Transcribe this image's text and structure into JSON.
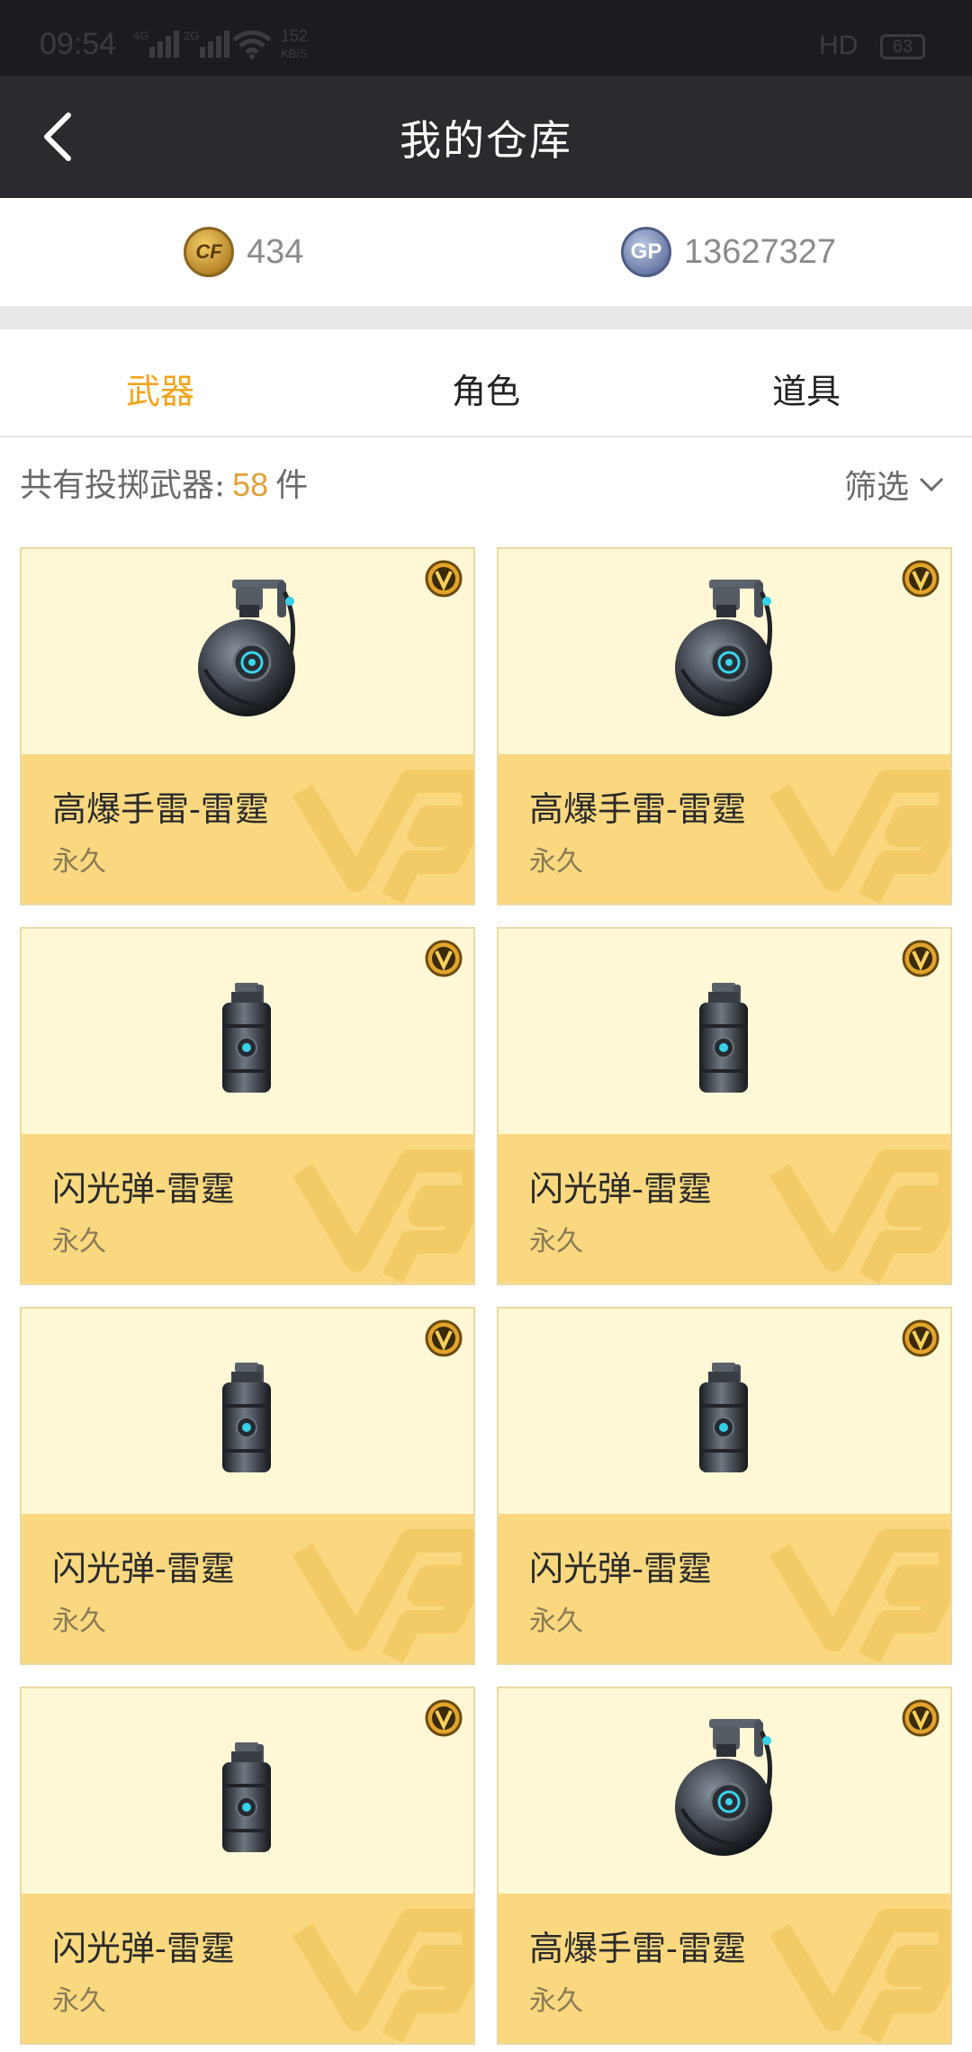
{
  "status_bar": {
    "time": "09:54",
    "net1": "4G",
    "net2": "2G",
    "speed_value": "152",
    "speed_unit": "KB/S",
    "hd": "HD",
    "battery": "63"
  },
  "header": {
    "title": "我的仓库"
  },
  "currency": {
    "cf_icon_text": "CF",
    "cf_value": "434",
    "gp_icon_text": "GP",
    "gp_value": "13627327"
  },
  "tabs": [
    {
      "label": "武器",
      "active": true
    },
    {
      "label": "角色",
      "active": false
    },
    {
      "label": "道具",
      "active": false
    }
  ],
  "summary": {
    "prefix": "共有投掷武器:",
    "count": "58",
    "suffix": "件",
    "filter_label": "筛选"
  },
  "items": [
    {
      "name": "高爆手雷-雷霆",
      "duration": "永久",
      "icon": "grenade-icon"
    },
    {
      "name": "高爆手雷-雷霆",
      "duration": "永久",
      "icon": "grenade-icon"
    },
    {
      "name": "闪光弹-雷霆",
      "duration": "永久",
      "icon": "flashbang-icon"
    },
    {
      "name": "闪光弹-雷霆",
      "duration": "永久",
      "icon": "flashbang-icon"
    },
    {
      "name": "闪光弹-雷霆",
      "duration": "永久",
      "icon": "flashbang-icon"
    },
    {
      "name": "闪光弹-雷霆",
      "duration": "永久",
      "icon": "flashbang-icon"
    },
    {
      "name": "闪光弹-雷霆",
      "duration": "永久",
      "icon": "flashbang-icon"
    },
    {
      "name": "高爆手雷-雷霆",
      "duration": "永久",
      "icon": "grenade-icon"
    }
  ],
  "colors": {
    "accent": "#f1a41d",
    "header_bg": "#2a2b2f",
    "card_top": "#fff8d6",
    "card_bottom": "#f9d87f"
  }
}
